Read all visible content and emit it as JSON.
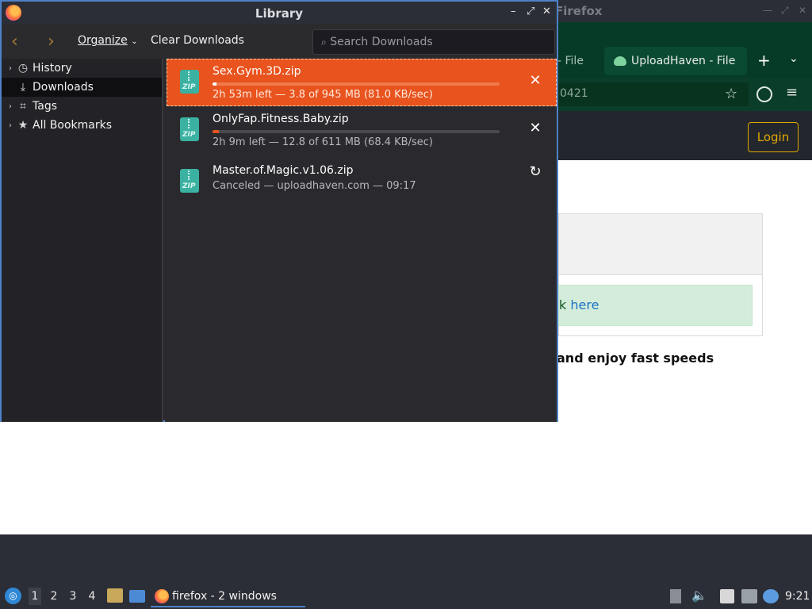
{
  "background_window": {
    "title": "Firefox",
    "tab_partial_label": "- File",
    "tab_label": "UploadHaven - File",
    "new_tab_symbol": "+",
    "url_partial": "0421",
    "login_label": "Login",
    "alert_partial": "k",
    "alert_link": "here",
    "promo_partial": "and enjoy fast speeds"
  },
  "library": {
    "title": "Library",
    "toolbar": {
      "organize_label": "Organize",
      "clear_downloads_label": "Clear Downloads",
      "search_placeholder": "Search Downloads"
    },
    "sidebar": {
      "items": [
        {
          "label": "History",
          "icon": "clock-icon"
        },
        {
          "label": "Downloads",
          "icon": "download-icon"
        },
        {
          "label": "Tags",
          "icon": "tag-icon"
        },
        {
          "label": "All Bookmarks",
          "icon": "star-icon"
        }
      ]
    },
    "downloads": [
      {
        "name": "Sex.Gym.3D.zip",
        "status": "2h 53m left — 3.8 of 945 MB (81.0 KB/sec)",
        "progress": 0.004,
        "action": "cancel",
        "active": true
      },
      {
        "name": "OnlyFap.Fitness.Baby.zip",
        "status": "2h 9m left — 12.8 of 611 MB (68.4 KB/sec)",
        "progress": 0.021,
        "action": "cancel",
        "active": false
      },
      {
        "name": "Master.of.Magic.v1.06.zip",
        "status": "Canceled — uploadhaven.com — 09:17",
        "progress": null,
        "action": "retry",
        "active": false
      }
    ],
    "icon_text": "ZIP"
  },
  "taskbar": {
    "workspaces": [
      "1",
      "2",
      "3",
      "4"
    ],
    "task_label": "firefox - 2 windows",
    "clock": "9:21"
  },
  "colors": {
    "accent": "#4f81c7",
    "download_active": "#e8531e",
    "site_green": "#053b27",
    "login_gold": "#e0a800"
  }
}
